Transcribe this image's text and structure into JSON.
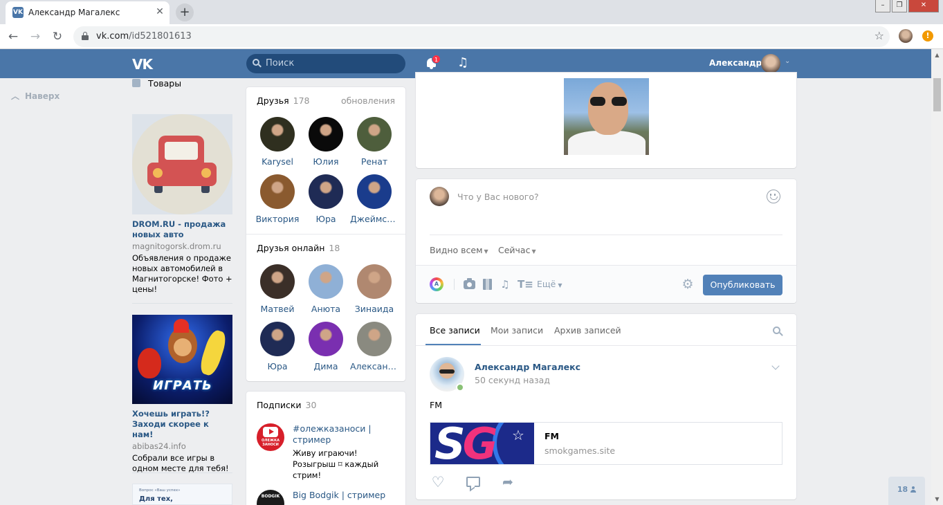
{
  "browser": {
    "tab_title": "Александр Магалекс",
    "tab_favicon": "VK",
    "url_domain": "vk.com",
    "url_path": "/id521801613"
  },
  "header": {
    "search_placeholder": "Поиск",
    "notifications_count": "1",
    "user_name": "Александр"
  },
  "left": {
    "back_to_top": "Наверх",
    "goods": "Товары",
    "ads": [
      {
        "title": "DROM.RU - продажа новых авто",
        "domain": "magnitogorsk.drom.ru",
        "text": "Объявления о продаже новых автомобилей в Магнитогорске! Фото + цены!"
      },
      {
        "title": "Хочешь играть!? Заходи скорее к нам!",
        "domain": "abibas24.info",
        "text": "Собрали все игры в одном месте для тебя!",
        "image_text": "ИГРАТЬ"
      }
    ],
    "promo": {
      "small": "Вопрос «Ваш успех»",
      "title": "Для тех,"
    }
  },
  "friends": {
    "title": "Друзья",
    "count": "178",
    "updates_link": "обновления",
    "items": [
      {
        "name": "Karysel",
        "color": "#2f2f1f"
      },
      {
        "name": "Юлия",
        "color": "#0a0a0a"
      },
      {
        "name": "Ренат",
        "color": "#4e5e3c"
      },
      {
        "name": "Виктория",
        "color": "#8a5a2f"
      },
      {
        "name": "Юра",
        "color": "#1f2b55"
      },
      {
        "name": "Джеймс-Б…",
        "color": "#1a3c8c"
      }
    ]
  },
  "friends_online": {
    "title": "Друзья онлайн",
    "count": "18",
    "items": [
      {
        "name": "Матвей",
        "color": "#3b2f28"
      },
      {
        "name": "Анюта",
        "color": "#8fb0d6"
      },
      {
        "name": "Зинаида",
        "color": "#b08870"
      },
      {
        "name": "Юра",
        "color": "#1f2b55"
      },
      {
        "name": "Дима",
        "color": "#7a2fb0"
      },
      {
        "name": "Александр",
        "color": "#8a8a80"
      }
    ]
  },
  "subscriptions": {
    "title": "Подписки",
    "count": "30",
    "items": [
      {
        "title": "#олежказаноси | стример",
        "desc": "Живу играючи! Розыгрыш ⌑ каждый стрим!",
        "avatar_text": "ОЛЕЖКА ЗАНОСИ"
      },
      {
        "title": "Big Bodgik | стример",
        "desc": "",
        "avatar_text": "BODGIK"
      }
    ]
  },
  "post_box": {
    "placeholder": "Что у Вас нового?",
    "visibility": "Видно всем",
    "time": "Сейчас",
    "more": "Ещё",
    "publish": "Опубликовать",
    "art_letter": "A"
  },
  "wall": {
    "tabs": [
      "Все записи",
      "Мои записи",
      "Архив записей"
    ],
    "post": {
      "author": "Александр Магалекс",
      "time": "50 секунд назад",
      "text": "FM",
      "snippet_title": "FM",
      "snippet_domain": "smokgames.site",
      "logo_s": "S",
      "logo_g": "G"
    }
  },
  "online_widget": {
    "count": "18"
  },
  "colors": {
    "vk_blue": "#4a76a8",
    "link": "#2a5885",
    "button": "#5181b8",
    "online": "#8ac176",
    "badge": "#ff3347"
  }
}
